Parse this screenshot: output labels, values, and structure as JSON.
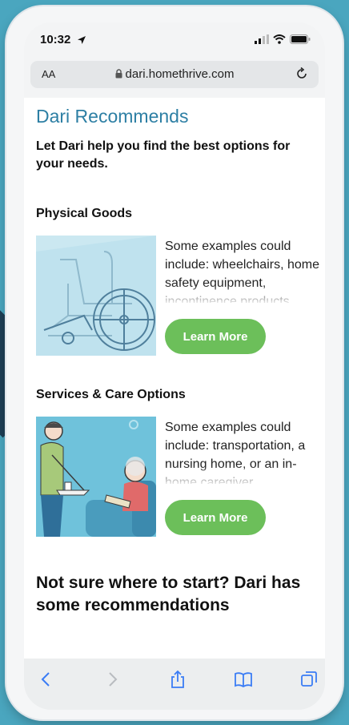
{
  "status_bar": {
    "time": "10:32"
  },
  "browser": {
    "text_size_label": "AA",
    "url": "dari.homethrive.com"
  },
  "page": {
    "title": "Dari Recommends",
    "subtitle": "Let Dari help you find the best options for your needs.",
    "sections": [
      {
        "heading": "Physical Goods",
        "description": "Some examples could include: wheelchairs, home safety equipment, incontinence products",
        "button_label": "Learn More"
      },
      {
        "heading": "Services & Care Options",
        "description": "Some examples could include: transportation, a nursing home, or an in-home caregiver",
        "button_label": "Learn More"
      }
    ],
    "bottom_heading": "Not sure where to start? Dari has some recommendations"
  },
  "colors": {
    "background": "#4aa6bf",
    "title": "#2d7fa4",
    "button": "#6cbf5a",
    "toolbar_icon": "#3a7cf5"
  },
  "icons": [
    "location-arrow-icon",
    "signal-icon",
    "wifi-icon",
    "battery-icon",
    "lock-icon",
    "reload-icon",
    "back-icon",
    "forward-icon",
    "share-icon",
    "bookmarks-icon",
    "tabs-icon"
  ]
}
